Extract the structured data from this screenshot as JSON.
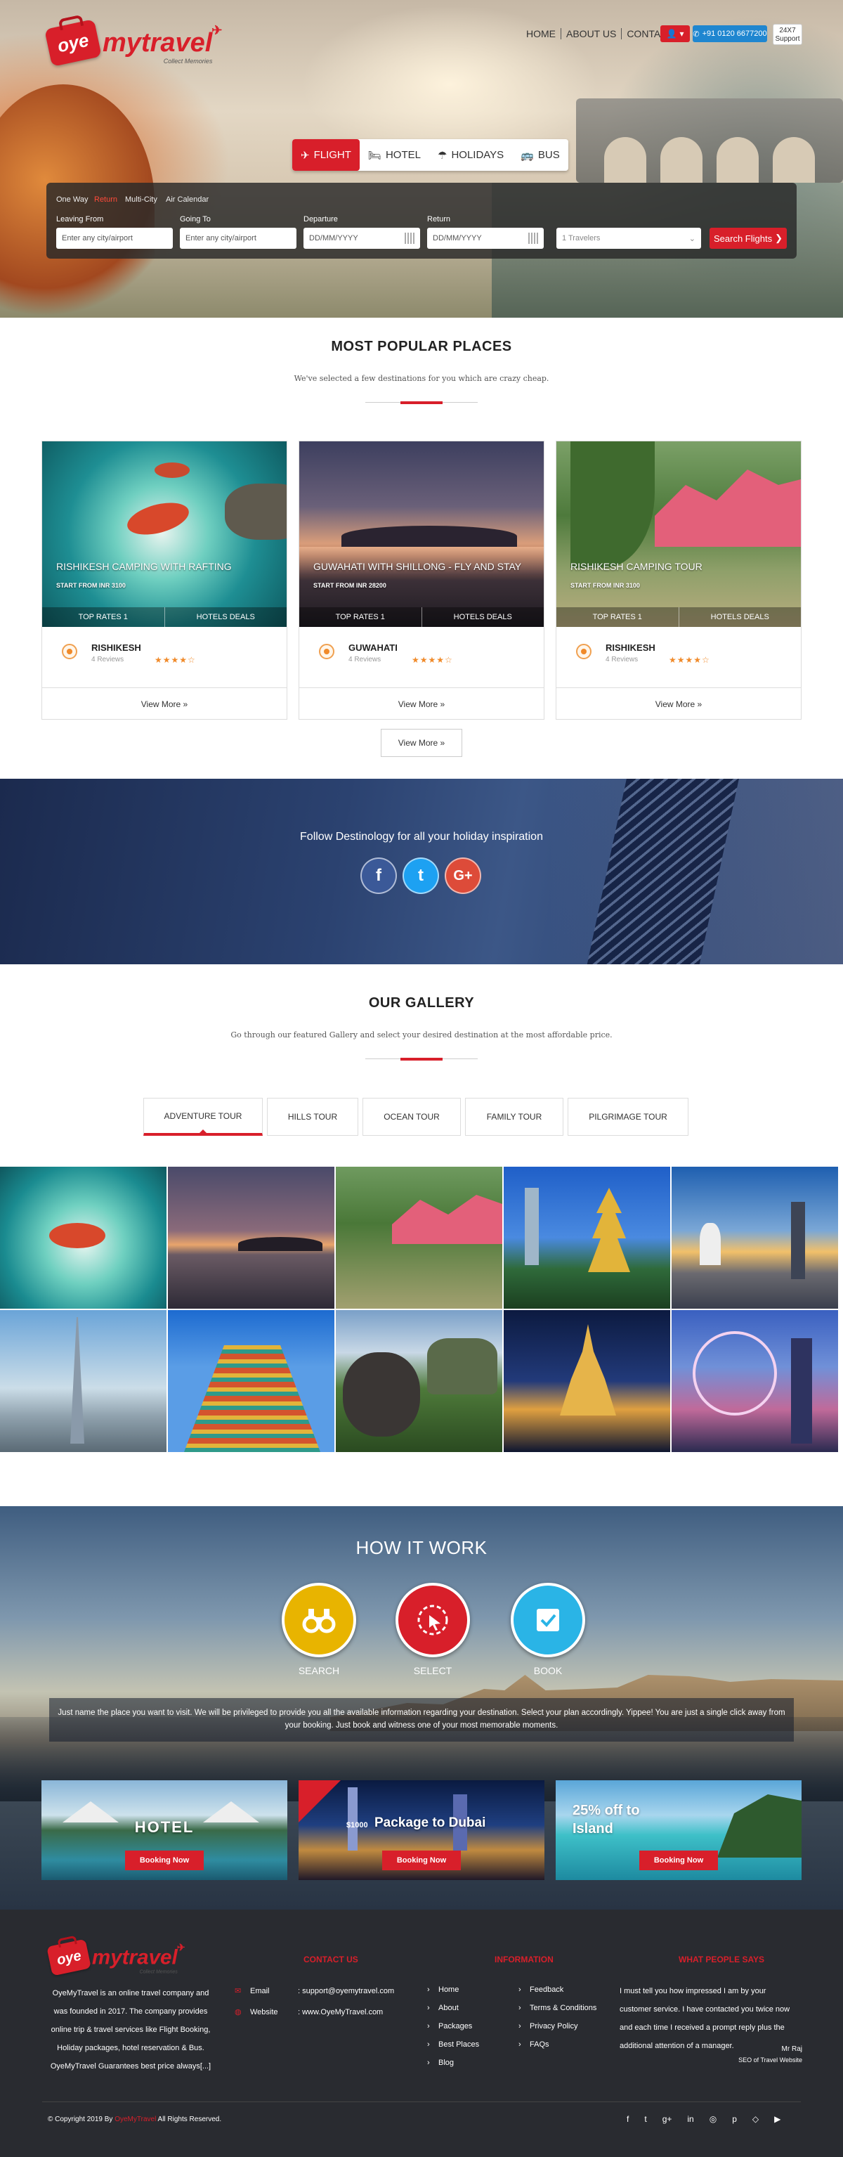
{
  "header": {
    "logo": {
      "badge": "oye",
      "word": "mytravel",
      "tagline": "Collect Memories"
    },
    "nav": [
      "HOME",
      "ABOUT US",
      "CONTACT US"
    ],
    "phone": "+91 0120 6677200",
    "support": {
      "line1": "24X7",
      "line2": "Support"
    },
    "icons": {
      "user": "user-icon",
      "phone": "phone-icon",
      "caret": "caret-down-icon"
    }
  },
  "tabs": [
    {
      "label": "FLIGHT",
      "icon": "plane-icon",
      "active": true
    },
    {
      "label": "HOTEL",
      "icon": "bed-icon"
    },
    {
      "label": "HOLIDAYS",
      "icon": "umbrella-icon"
    },
    {
      "label": "BUS",
      "icon": "bus-icon"
    }
  ],
  "search": {
    "types": [
      "One Way",
      "Return",
      "Multi-City",
      "Air Calendar"
    ],
    "active_type": "Return",
    "leaving_label": "Leaving From",
    "leaving_placeholder": "Enter any city/airport",
    "going_label": "Going To",
    "going_placeholder": "Enter any city/airport",
    "depart_label": "Departure",
    "depart_placeholder": "DD/MM/YYYY",
    "return_label": "Return",
    "return_placeholder": "DD/MM/YYYY",
    "travelers": "1 Travelers",
    "button": "Search Flights"
  },
  "popular": {
    "title": "MOST POPULAR PLACES",
    "subtitle": "We've selected a few destinations for you which are crazy cheap.",
    "cards": [
      {
        "overlay_title": "RISHIKESH CAMPING WITH RAFTING",
        "start": "START FROM INR 3100",
        "left": "TOP RATES 1",
        "right": "HOTELS DEALS",
        "name": "RISHIKESH",
        "reviews": "4 Reviews",
        "stars": "★★★★☆",
        "view": "View More »"
      },
      {
        "overlay_title": "GUWAHATI WITH SHILLONG - FLY AND STAY",
        "start": "START FROM INR 28200",
        "left": "TOP RATES 1",
        "right": "HOTELS DEALS",
        "name": "GUWAHATI",
        "reviews": "4 Reviews",
        "stars": "★★★★☆",
        "view": "View More »"
      },
      {
        "overlay_title": "RISHIKESH CAMPING TOUR",
        "start": "START FROM INR 3100",
        "left": "TOP RATES 1",
        "right": "HOTELS DEALS",
        "name": "RISHIKESH",
        "reviews": "4 Reviews",
        "stars": "★★★★☆",
        "view": "View More »"
      }
    ],
    "view_all": "View More »"
  },
  "social": {
    "text": "Follow Destinology for all your holiday inspiration",
    "icons": [
      {
        "name": "facebook-icon",
        "glyph": "f",
        "color": "#3b5998"
      },
      {
        "name": "twitter-icon",
        "glyph": "t",
        "color": "#1da1f2"
      },
      {
        "name": "google-plus-icon",
        "glyph": "G+",
        "color": "#dd4b39"
      }
    ]
  },
  "gallery": {
    "title": "OUR GALLERY",
    "subtitle": "Go through our featured Gallery and select your desired destination at the most affordable price.",
    "tabs": [
      "ADVENTURE TOUR",
      "HILLS TOUR",
      "OCEAN TOUR",
      "FAMILY TOUR",
      "PILGRIMAGE TOUR"
    ],
    "active_tab": "ADVENTURE TOUR"
  },
  "how": {
    "title": "HOW IT WORK",
    "steps": [
      {
        "label": "SEARCH",
        "icon": "binoculars-icon"
      },
      {
        "label": "SELECT",
        "icon": "cursor-icon"
      },
      {
        "label": "BOOK",
        "icon": "checkbox-icon"
      }
    ],
    "text": "Just name the place you want to visit. We will be privileged to provide you all the available information regarding your destination. Select your plan accordingly. Yippee! You are just a single click away from your booking. Just book and witness one of your most memorable moments."
  },
  "promos": [
    {
      "text": "HOTEL",
      "button": "Booking Now"
    },
    {
      "text": "Package to Dubai",
      "price": "$1000",
      "button": "Booking Now"
    },
    {
      "text": "25% off to Island",
      "button": "Booking Now"
    }
  ],
  "footer": {
    "about": "OyeMyTravel is an online travel company and was founded in 2017. The company provides online trip & travel services like Flight Booking, Holiday packages, hotel reservation & Bus. OyeMyTravel Guarantees best price always[...]",
    "contact_head": "CONTACT US",
    "email_label": "Email",
    "email": ": support@oyemytravel.com",
    "website_label": "Website",
    "website": ": www.OyeMyTravel.com",
    "info_head": "INFORMATION",
    "info_col1": [
      "Home",
      "About",
      "Packages",
      "Best Places",
      "Blog"
    ],
    "info_col2": [
      "Feedback",
      "Terms & Conditions",
      "Privacy Policy",
      "FAQs"
    ],
    "testimonial_head": "WHAT PEOPLE SAYS",
    "testimonial": "I must tell you how impressed I am by your customer service. I have contacted you twice now and each time I received a prompt reply plus the additional attention of a manager.",
    "author": "Mr Raj",
    "author_title": "SEO of Travel Website",
    "copyright": "© Copyright 2019 By",
    "copyright_brand": "OyeMyTravel",
    "copyright_rest": "All Rights Reserved.",
    "social": [
      "f",
      "t",
      "g+",
      "in",
      "◎",
      "p",
      "◇",
      "▶"
    ]
  }
}
